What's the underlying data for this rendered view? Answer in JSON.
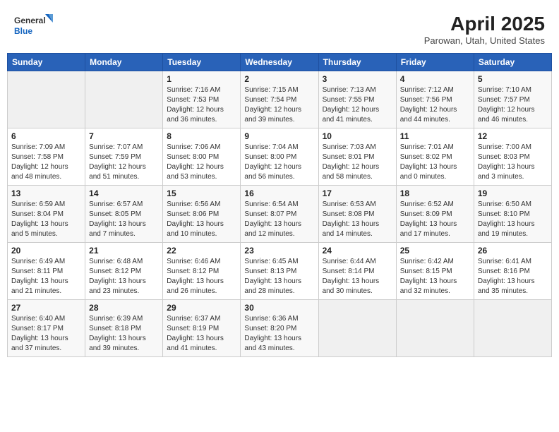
{
  "header": {
    "logo_general": "General",
    "logo_blue": "Blue",
    "title": "April 2025",
    "location": "Parowan, Utah, United States"
  },
  "weekdays": [
    "Sunday",
    "Monday",
    "Tuesday",
    "Wednesday",
    "Thursday",
    "Friday",
    "Saturday"
  ],
  "weeks": [
    [
      {
        "day": "",
        "content": ""
      },
      {
        "day": "",
        "content": ""
      },
      {
        "day": "1",
        "content": "Sunrise: 7:16 AM\nSunset: 7:53 PM\nDaylight: 12 hours and 36 minutes."
      },
      {
        "day": "2",
        "content": "Sunrise: 7:15 AM\nSunset: 7:54 PM\nDaylight: 12 hours and 39 minutes."
      },
      {
        "day": "3",
        "content": "Sunrise: 7:13 AM\nSunset: 7:55 PM\nDaylight: 12 hours and 41 minutes."
      },
      {
        "day": "4",
        "content": "Sunrise: 7:12 AM\nSunset: 7:56 PM\nDaylight: 12 hours and 44 minutes."
      },
      {
        "day": "5",
        "content": "Sunrise: 7:10 AM\nSunset: 7:57 PM\nDaylight: 12 hours and 46 minutes."
      }
    ],
    [
      {
        "day": "6",
        "content": "Sunrise: 7:09 AM\nSunset: 7:58 PM\nDaylight: 12 hours and 48 minutes."
      },
      {
        "day": "7",
        "content": "Sunrise: 7:07 AM\nSunset: 7:59 PM\nDaylight: 12 hours and 51 minutes."
      },
      {
        "day": "8",
        "content": "Sunrise: 7:06 AM\nSunset: 8:00 PM\nDaylight: 12 hours and 53 minutes."
      },
      {
        "day": "9",
        "content": "Sunrise: 7:04 AM\nSunset: 8:00 PM\nDaylight: 12 hours and 56 minutes."
      },
      {
        "day": "10",
        "content": "Sunrise: 7:03 AM\nSunset: 8:01 PM\nDaylight: 12 hours and 58 minutes."
      },
      {
        "day": "11",
        "content": "Sunrise: 7:01 AM\nSunset: 8:02 PM\nDaylight: 13 hours and 0 minutes."
      },
      {
        "day": "12",
        "content": "Sunrise: 7:00 AM\nSunset: 8:03 PM\nDaylight: 13 hours and 3 minutes."
      }
    ],
    [
      {
        "day": "13",
        "content": "Sunrise: 6:59 AM\nSunset: 8:04 PM\nDaylight: 13 hours and 5 minutes."
      },
      {
        "day": "14",
        "content": "Sunrise: 6:57 AM\nSunset: 8:05 PM\nDaylight: 13 hours and 7 minutes."
      },
      {
        "day": "15",
        "content": "Sunrise: 6:56 AM\nSunset: 8:06 PM\nDaylight: 13 hours and 10 minutes."
      },
      {
        "day": "16",
        "content": "Sunrise: 6:54 AM\nSunset: 8:07 PM\nDaylight: 13 hours and 12 minutes."
      },
      {
        "day": "17",
        "content": "Sunrise: 6:53 AM\nSunset: 8:08 PM\nDaylight: 13 hours and 14 minutes."
      },
      {
        "day": "18",
        "content": "Sunrise: 6:52 AM\nSunset: 8:09 PM\nDaylight: 13 hours and 17 minutes."
      },
      {
        "day": "19",
        "content": "Sunrise: 6:50 AM\nSunset: 8:10 PM\nDaylight: 13 hours and 19 minutes."
      }
    ],
    [
      {
        "day": "20",
        "content": "Sunrise: 6:49 AM\nSunset: 8:11 PM\nDaylight: 13 hours and 21 minutes."
      },
      {
        "day": "21",
        "content": "Sunrise: 6:48 AM\nSunset: 8:12 PM\nDaylight: 13 hours and 23 minutes."
      },
      {
        "day": "22",
        "content": "Sunrise: 6:46 AM\nSunset: 8:12 PM\nDaylight: 13 hours and 26 minutes."
      },
      {
        "day": "23",
        "content": "Sunrise: 6:45 AM\nSunset: 8:13 PM\nDaylight: 13 hours and 28 minutes."
      },
      {
        "day": "24",
        "content": "Sunrise: 6:44 AM\nSunset: 8:14 PM\nDaylight: 13 hours and 30 minutes."
      },
      {
        "day": "25",
        "content": "Sunrise: 6:42 AM\nSunset: 8:15 PM\nDaylight: 13 hours and 32 minutes."
      },
      {
        "day": "26",
        "content": "Sunrise: 6:41 AM\nSunset: 8:16 PM\nDaylight: 13 hours and 35 minutes."
      }
    ],
    [
      {
        "day": "27",
        "content": "Sunrise: 6:40 AM\nSunset: 8:17 PM\nDaylight: 13 hours and 37 minutes."
      },
      {
        "day": "28",
        "content": "Sunrise: 6:39 AM\nSunset: 8:18 PM\nDaylight: 13 hours and 39 minutes."
      },
      {
        "day": "29",
        "content": "Sunrise: 6:37 AM\nSunset: 8:19 PM\nDaylight: 13 hours and 41 minutes."
      },
      {
        "day": "30",
        "content": "Sunrise: 6:36 AM\nSunset: 8:20 PM\nDaylight: 13 hours and 43 minutes."
      },
      {
        "day": "",
        "content": ""
      },
      {
        "day": "",
        "content": ""
      },
      {
        "day": "",
        "content": ""
      }
    ]
  ]
}
